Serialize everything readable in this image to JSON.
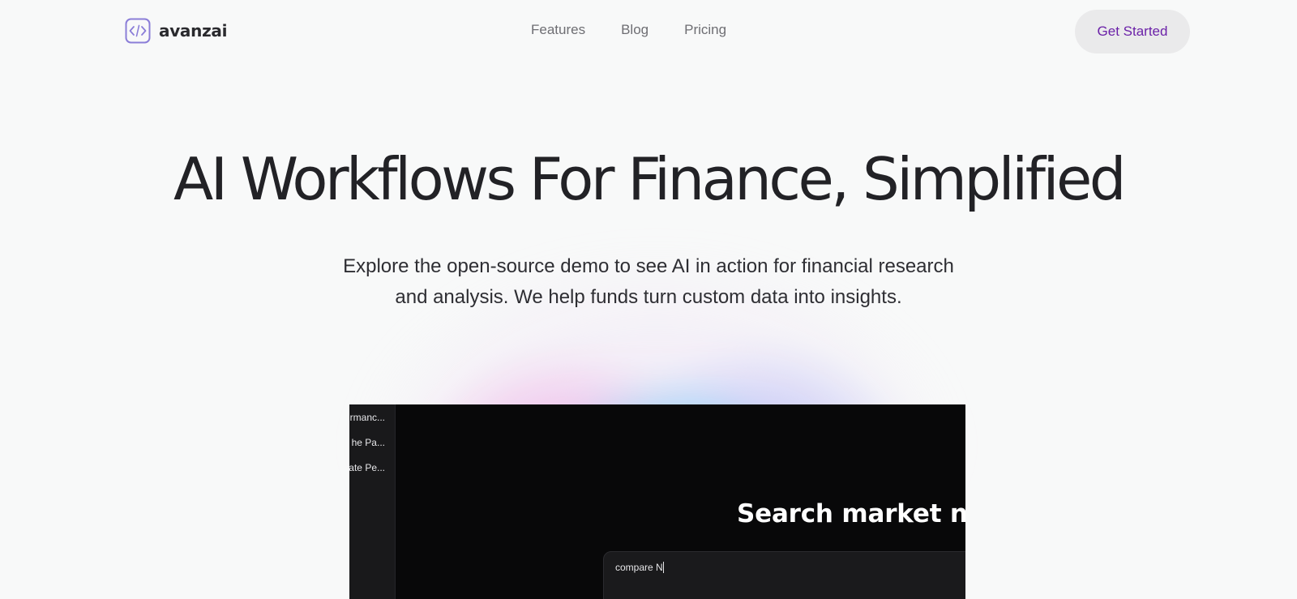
{
  "brand": {
    "name": "avanzai",
    "logo_icon": "code-brackets-icon",
    "accent": "#6b21a8",
    "logo_color": "#8b7ed8"
  },
  "nav": {
    "items": [
      {
        "label": "Features"
      },
      {
        "label": "Blog"
      },
      {
        "label": "Pricing"
      }
    ]
  },
  "header": {
    "cta_label": "Get Started"
  },
  "hero": {
    "title": "AI Workflows For Finance, Simplified",
    "subtitle_line1": "Explore the open-source demo to see AI in action for financial research",
    "subtitle_line2": "and analysis. We help funds turn custom data into insights."
  },
  "preview": {
    "threads": [
      {
        "label": "rmanc..."
      },
      {
        "label": "he Pa..."
      },
      {
        "label": "ate Pe..."
      }
    ],
    "heading": "Search market nev",
    "input_value": "compare N"
  }
}
